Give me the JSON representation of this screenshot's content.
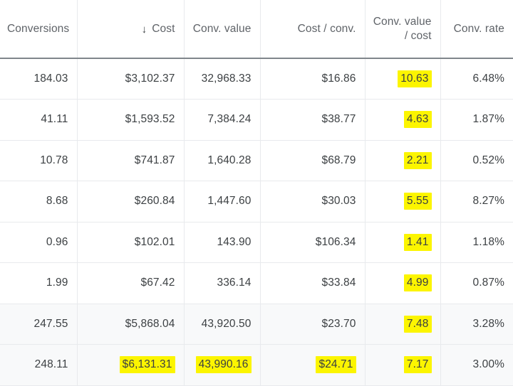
{
  "table": {
    "name": "performance-metrics-table",
    "sort": {
      "column": "Cost",
      "direction": "descending",
      "arrow_glyph": "↓"
    },
    "highlight_color": "#fcf500",
    "columns": [
      {
        "key": "conversions",
        "label": "Conversions",
        "align": "left",
        "sorted": false
      },
      {
        "key": "cost",
        "label": "Cost",
        "align": "right",
        "sorted": true
      },
      {
        "key": "conv_value",
        "label": "Conv. value",
        "align": "right",
        "sorted": false
      },
      {
        "key": "cost_per_conv",
        "label": "Cost / conv.",
        "align": "right",
        "sorted": false
      },
      {
        "key": "conv_value_cost",
        "label": "Conv. value\n/ cost",
        "align": "right",
        "sorted": false
      },
      {
        "key": "conv_rate",
        "label": "Conv. rate",
        "align": "right",
        "sorted": false
      }
    ],
    "rows": [
      {
        "type": "data",
        "conversions": "184.03",
        "cost": "$3,102.37",
        "conv_value": "32,968.33",
        "cost_per_conv": "$16.86",
        "conv_value_cost": "10.63",
        "conv_rate": "6.48%",
        "highlighted": [
          "conv_value_cost"
        ]
      },
      {
        "type": "data",
        "conversions": "41.11",
        "cost": "$1,593.52",
        "conv_value": "7,384.24",
        "cost_per_conv": "$38.77",
        "conv_value_cost": "4.63",
        "conv_rate": "1.87%",
        "highlighted": [
          "conv_value_cost"
        ]
      },
      {
        "type": "data",
        "conversions": "10.78",
        "cost": "$741.87",
        "conv_value": "1,640.28",
        "cost_per_conv": "$68.79",
        "conv_value_cost": "2.21",
        "conv_rate": "0.52%",
        "highlighted": [
          "conv_value_cost"
        ]
      },
      {
        "type": "data",
        "conversions": "8.68",
        "cost": "$260.84",
        "conv_value": "1,447.60",
        "cost_per_conv": "$30.03",
        "conv_value_cost": "5.55",
        "conv_rate": "8.27%",
        "highlighted": [
          "conv_value_cost"
        ]
      },
      {
        "type": "data",
        "conversions": "0.96",
        "cost": "$102.01",
        "conv_value": "143.90",
        "cost_per_conv": "$106.34",
        "conv_value_cost": "1.41",
        "conv_rate": "1.18%",
        "highlighted": [
          "conv_value_cost"
        ]
      },
      {
        "type": "data",
        "conversions": "1.99",
        "cost": "$67.42",
        "conv_value": "336.14",
        "cost_per_conv": "$33.84",
        "conv_value_cost": "4.99",
        "conv_rate": "0.87%",
        "highlighted": [
          "conv_value_cost"
        ]
      },
      {
        "type": "summary",
        "conversions": "247.55",
        "cost": "$5,868.04",
        "conv_value": "43,920.50",
        "cost_per_conv": "$23.70",
        "conv_value_cost": "7.48",
        "conv_rate": "3.28%",
        "highlighted": [
          "conv_value_cost"
        ]
      },
      {
        "type": "summary",
        "conversions": "248.11",
        "cost": "$6,131.31",
        "conv_value": "43,990.16",
        "cost_per_conv": "$24.71",
        "conv_value_cost": "7.17",
        "conv_rate": "3.00%",
        "highlighted": [
          "cost",
          "conv_value",
          "cost_per_conv",
          "conv_value_cost"
        ]
      }
    ]
  }
}
